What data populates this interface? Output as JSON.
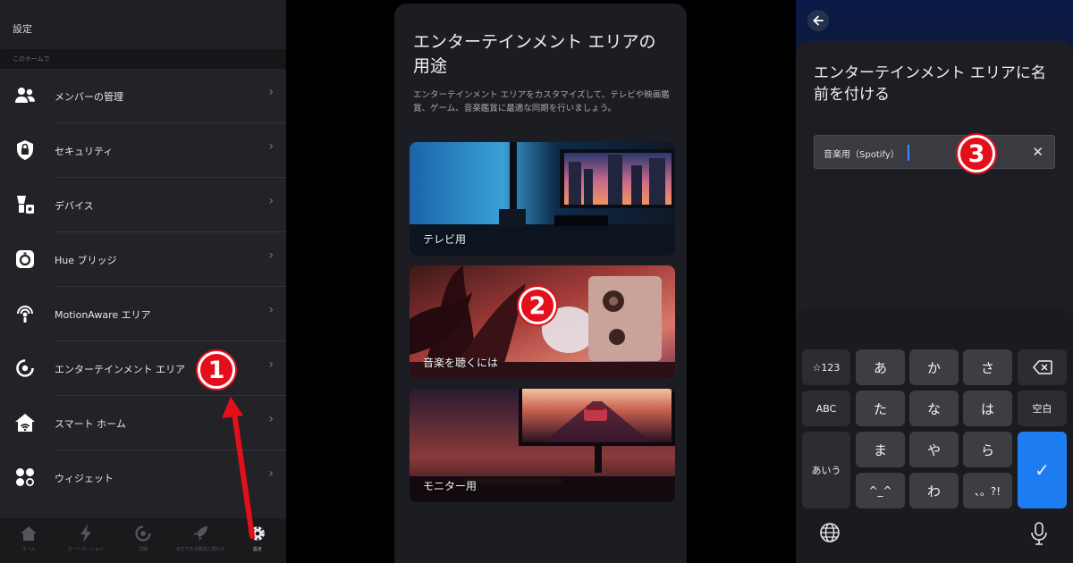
{
  "settings": {
    "title": "設定",
    "section_caption": "このホームで",
    "items": [
      {
        "label": "メンバーの管理",
        "icon": "members-icon"
      },
      {
        "label": "セキュリティ",
        "icon": "security-icon"
      },
      {
        "label": "デバイス",
        "icon": "devices-icon"
      },
      {
        "label": "Hue ブリッジ",
        "icon": "hue-bridge-icon"
      },
      {
        "label": "MotionAware エリア",
        "icon": "motionaware-icon"
      },
      {
        "label": "エンターテインメント エリア",
        "icon": "entertainment-icon"
      },
      {
        "label": "スマート ホーム",
        "icon": "smart-home-icon"
      },
      {
        "label": "ウィジェット",
        "icon": "widgets-icon"
      }
    ],
    "tabs": [
      {
        "label": "ホーム",
        "icon": "home-icon"
      },
      {
        "label": "オートメーション",
        "icon": "automation-icon"
      },
      {
        "label": "同期",
        "icon": "sync-icon"
      },
      {
        "label": "まだできる限定に限れる",
        "icon": "rocket-icon"
      },
      {
        "label": "設定",
        "icon": "gear-icon"
      }
    ]
  },
  "use_screen": {
    "title": "エンターテインメント エリアの用途",
    "description": "エンターテインメント エリアをカスタマイズして、テレビや映画鑑賞、ゲーム、音楽鑑賞に最適な同期を行いましょう。",
    "cards": [
      {
        "label": "テレビ用"
      },
      {
        "label": "音楽を聴くには"
      },
      {
        "label": "モニター用"
      }
    ]
  },
  "name_screen": {
    "title": "エンターテインメント エリアに名前を付ける",
    "input_value": "音楽用（Spotify）",
    "keyboard": {
      "row1": [
        "☆123",
        "あ",
        "か",
        "さ"
      ],
      "row2": [
        "ABC",
        "た",
        "な",
        "は",
        "空白"
      ],
      "row3": [
        "あいう",
        "ま",
        "や",
        "ら"
      ],
      "row4": [
        "^_^",
        "わ",
        "、。?!"
      ],
      "enter": "✓"
    }
  },
  "annotations": {
    "step1": "1",
    "step2": "2",
    "step3": "3"
  },
  "colors": {
    "annotation_red": "#e30f1a",
    "keyboard_accent": "#1e7cf2",
    "caret": "#3b8cff"
  }
}
